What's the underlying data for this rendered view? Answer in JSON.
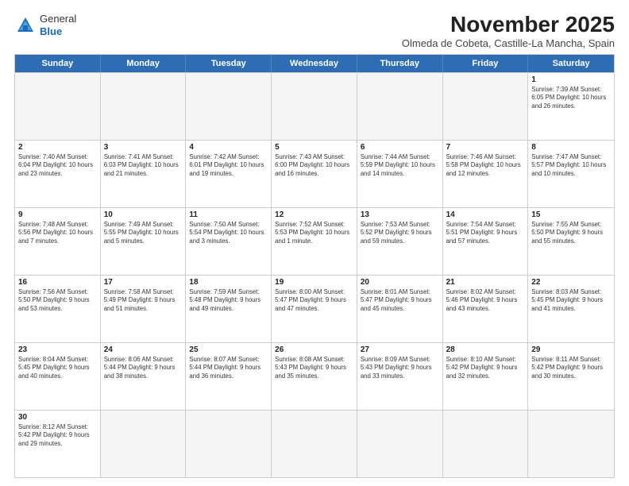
{
  "header": {
    "logo": {
      "general": "General",
      "blue": "Blue"
    },
    "title": "November 2025",
    "location": "Olmeda de Cobeta, Castille-La Mancha, Spain"
  },
  "weekdays": [
    "Sunday",
    "Monday",
    "Tuesday",
    "Wednesday",
    "Thursday",
    "Friday",
    "Saturday"
  ],
  "weeks": [
    [
      {
        "day": "",
        "info": ""
      },
      {
        "day": "",
        "info": ""
      },
      {
        "day": "",
        "info": ""
      },
      {
        "day": "",
        "info": ""
      },
      {
        "day": "",
        "info": ""
      },
      {
        "day": "",
        "info": ""
      },
      {
        "day": "1",
        "info": "Sunrise: 7:39 AM\nSunset: 6:05 PM\nDaylight: 10 hours\nand 26 minutes."
      }
    ],
    [
      {
        "day": "2",
        "info": "Sunrise: 7:40 AM\nSunset: 6:04 PM\nDaylight: 10 hours\nand 23 minutes."
      },
      {
        "day": "3",
        "info": "Sunrise: 7:41 AM\nSunset: 6:03 PM\nDaylight: 10 hours\nand 21 minutes."
      },
      {
        "day": "4",
        "info": "Sunrise: 7:42 AM\nSunset: 6:01 PM\nDaylight: 10 hours\nand 19 minutes."
      },
      {
        "day": "5",
        "info": "Sunrise: 7:43 AM\nSunset: 6:00 PM\nDaylight: 10 hours\nand 16 minutes."
      },
      {
        "day": "6",
        "info": "Sunrise: 7:44 AM\nSunset: 5:59 PM\nDaylight: 10 hours\nand 14 minutes."
      },
      {
        "day": "7",
        "info": "Sunrise: 7:46 AM\nSunset: 5:58 PM\nDaylight: 10 hours\nand 12 minutes."
      },
      {
        "day": "8",
        "info": "Sunrise: 7:47 AM\nSunset: 5:57 PM\nDaylight: 10 hours\nand 10 minutes."
      }
    ],
    [
      {
        "day": "9",
        "info": "Sunrise: 7:48 AM\nSunset: 5:56 PM\nDaylight: 10 hours\nand 7 minutes."
      },
      {
        "day": "10",
        "info": "Sunrise: 7:49 AM\nSunset: 5:55 PM\nDaylight: 10 hours\nand 5 minutes."
      },
      {
        "day": "11",
        "info": "Sunrise: 7:50 AM\nSunset: 5:54 PM\nDaylight: 10 hours\nand 3 minutes."
      },
      {
        "day": "12",
        "info": "Sunrise: 7:52 AM\nSunset: 5:53 PM\nDaylight: 10 hours\nand 1 minute."
      },
      {
        "day": "13",
        "info": "Sunrise: 7:53 AM\nSunset: 5:52 PM\nDaylight: 9 hours\nand 59 minutes."
      },
      {
        "day": "14",
        "info": "Sunrise: 7:54 AM\nSunset: 5:51 PM\nDaylight: 9 hours\nand 57 minutes."
      },
      {
        "day": "15",
        "info": "Sunrise: 7:55 AM\nSunset: 5:50 PM\nDaylight: 9 hours\nand 55 minutes."
      }
    ],
    [
      {
        "day": "16",
        "info": "Sunrise: 7:56 AM\nSunset: 5:50 PM\nDaylight: 9 hours\nand 53 minutes."
      },
      {
        "day": "17",
        "info": "Sunrise: 7:58 AM\nSunset: 5:49 PM\nDaylight: 9 hours\nand 51 minutes."
      },
      {
        "day": "18",
        "info": "Sunrise: 7:59 AM\nSunset: 5:48 PM\nDaylight: 9 hours\nand 49 minutes."
      },
      {
        "day": "19",
        "info": "Sunrise: 8:00 AM\nSunset: 5:47 PM\nDaylight: 9 hours\nand 47 minutes."
      },
      {
        "day": "20",
        "info": "Sunrise: 8:01 AM\nSunset: 5:47 PM\nDaylight: 9 hours\nand 45 minutes."
      },
      {
        "day": "21",
        "info": "Sunrise: 8:02 AM\nSunset: 5:46 PM\nDaylight: 9 hours\nand 43 minutes."
      },
      {
        "day": "22",
        "info": "Sunrise: 8:03 AM\nSunset: 5:45 PM\nDaylight: 9 hours\nand 41 minutes."
      }
    ],
    [
      {
        "day": "23",
        "info": "Sunrise: 8:04 AM\nSunset: 5:45 PM\nDaylight: 9 hours\nand 40 minutes."
      },
      {
        "day": "24",
        "info": "Sunrise: 8:06 AM\nSunset: 5:44 PM\nDaylight: 9 hours\nand 38 minutes."
      },
      {
        "day": "25",
        "info": "Sunrise: 8:07 AM\nSunset: 5:44 PM\nDaylight: 9 hours\nand 36 minutes."
      },
      {
        "day": "26",
        "info": "Sunrise: 8:08 AM\nSunset: 5:43 PM\nDaylight: 9 hours\nand 35 minutes."
      },
      {
        "day": "27",
        "info": "Sunrise: 8:09 AM\nSunset: 5:43 PM\nDaylight: 9 hours\nand 33 minutes."
      },
      {
        "day": "28",
        "info": "Sunrise: 8:10 AM\nSunset: 5:42 PM\nDaylight: 9 hours\nand 32 minutes."
      },
      {
        "day": "29",
        "info": "Sunrise: 8:11 AM\nSunset: 5:42 PM\nDaylight: 9 hours\nand 30 minutes."
      }
    ],
    [
      {
        "day": "30",
        "info": "Sunrise: 8:12 AM\nSunset: 5:42 PM\nDaylight: 9 hours\nand 29 minutes."
      },
      {
        "day": "",
        "info": ""
      },
      {
        "day": "",
        "info": ""
      },
      {
        "day": "",
        "info": ""
      },
      {
        "day": "",
        "info": ""
      },
      {
        "day": "",
        "info": ""
      },
      {
        "day": "",
        "info": ""
      }
    ]
  ]
}
